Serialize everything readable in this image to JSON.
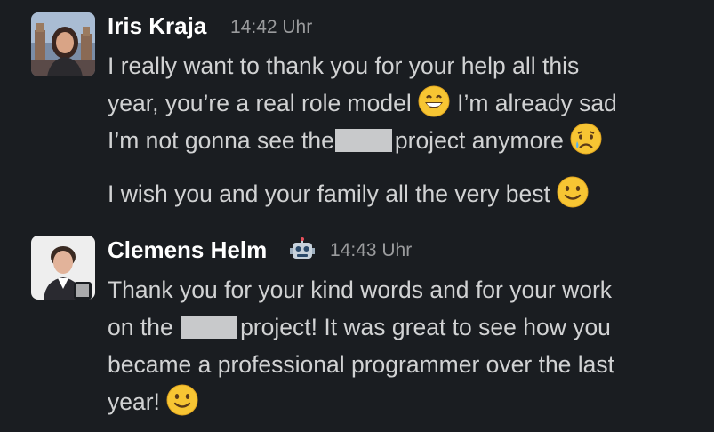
{
  "messages": [
    {
      "author": "Iris Kraja",
      "time": "14:42 Uhr",
      "lines": [
        "I really want to thank you for your help all this",
        "year, you’re a real role model",
        "I’m already sad",
        "I’m not gonna see the",
        "project anymore",
        "I wish you and your family all the very best"
      ],
      "emojis": [
        "grinning-face-emoji",
        "crying-face-emoji",
        "slightly-smiling-face-emoji"
      ]
    },
    {
      "author": "Clemens Helm",
      "time": "14:43 Uhr",
      "badge": "robot-face-emoji",
      "lines": [
        "Thank you for your kind words and for your work",
        "on the",
        "project! It was great to see how you",
        "became a professional programmer over the last",
        "year!"
      ],
      "emojis": [
        "slightly-smiling-face-emoji"
      ]
    }
  ],
  "colors": {
    "background": "#1a1d21",
    "name": "#ffffff",
    "text": "#d1d2d3",
    "timestamp": "#9a9b9d",
    "redaction": "#c8c9cb",
    "emoji_yellow": "#f7c533"
  }
}
